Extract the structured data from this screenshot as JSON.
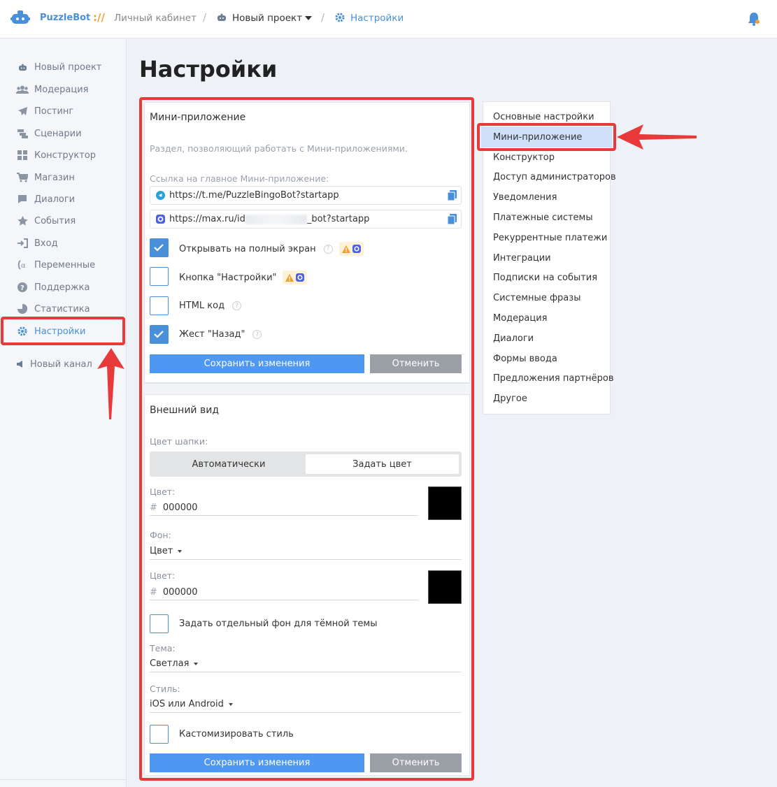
{
  "header": {
    "brand": "PuzzleBot",
    "brand_sep": "://",
    "crumb_cabinet": "Личный кабинет",
    "crumb_project": "Новый проект",
    "crumb_settings": "Настройки",
    "slash": "/"
  },
  "sidebar": {
    "items": [
      {
        "label": "Новый проект",
        "icon": "bot-icon"
      },
      {
        "label": "Модерация",
        "icon": "users-icon"
      },
      {
        "label": "Постинг",
        "icon": "send-icon"
      },
      {
        "label": "Сценарии",
        "icon": "scenarios-icon"
      },
      {
        "label": "Конструктор",
        "icon": "grid-icon"
      },
      {
        "label": "Магазин",
        "icon": "cart-icon"
      },
      {
        "label": "Диалоги",
        "icon": "chat-icon"
      },
      {
        "label": "События",
        "icon": "star-icon"
      },
      {
        "label": "Вход",
        "icon": "login-icon"
      },
      {
        "label": "Переменные",
        "icon": "variable-icon"
      },
      {
        "label": "Поддержка",
        "icon": "question-icon"
      },
      {
        "label": "Статистика",
        "icon": "pie-icon"
      },
      {
        "label": "Настройки",
        "icon": "gear-icon"
      }
    ],
    "new_channel": "Новый канал"
  },
  "page": {
    "title": "Настройки"
  },
  "mini_app": {
    "title": "Мини-приложение",
    "description": "Раздел, позволяющий работать с Мини-приложениями.",
    "link_label": "Ссылка на главное Мини-приложение:",
    "link_telegram": "https://t.me/PuzzleBingoBot?startapp",
    "link_max_prefix": "https://max.ru/id",
    "link_max_suffix": "_bot?startapp",
    "fullscreen_label": "Открывать на полный экран",
    "fullscreen_checked": true,
    "settings_button_label": "Кнопка \"Настройки\"",
    "settings_button_checked": false,
    "html_label": "HTML код",
    "html_checked": false,
    "back_gesture_label": "Жест \"Назад\"",
    "back_gesture_checked": true,
    "save": "Сохранить изменения",
    "cancel": "Отменить",
    "help": "?"
  },
  "appearance": {
    "title": "Внешний вид",
    "header_color_label": "Цвет шапки:",
    "seg_auto": "Автоматически",
    "seg_custom": "Задать цвет",
    "color_label": "Цвет:",
    "hash": "#",
    "color_value": "000000",
    "color_hex": "#000000",
    "bg_label": "Фон:",
    "bg_value": "Цвет",
    "color2_label": "Цвет:",
    "color2_value": "000000",
    "dark_bg_label": "Задать отдельный фон для тёмной темы",
    "theme_label": "Тема:",
    "theme_value": "Светлая",
    "style_label": "Стиль:",
    "style_value": "iOS или Android",
    "customize_label": "Кастомизировать стиль",
    "save": "Сохранить изменения",
    "cancel": "Отменить"
  },
  "settings_nav": {
    "items": [
      "Основные настройки",
      "Мини-приложение",
      "Конструктор",
      "Доступ администраторов",
      "Уведомления",
      "Платежные системы",
      "Рекуррентные платежи",
      "Интеграции",
      "Подписки на события",
      "Системные фразы",
      "Модерация",
      "Диалоги",
      "Формы ввода",
      "Предложения партнёров",
      "Другое"
    ],
    "active_index": 1
  },
  "colors": {
    "accent": "#4a90d9",
    "highlight": "#e83a3a",
    "button_save": "#4f98f2",
    "button_cancel": "#9aa0a6"
  }
}
